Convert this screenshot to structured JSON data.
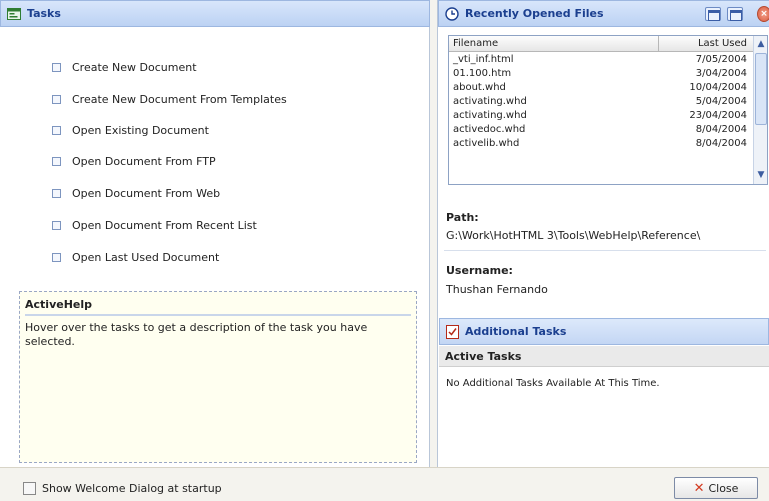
{
  "tasks": {
    "title": "Tasks",
    "items": [
      "Create New Document",
      "Create New Document From Templates",
      "Open Existing Document",
      "Open Document From FTP",
      "Open Document From Web",
      "Open Document From Recent List",
      "Open Last Used Document"
    ]
  },
  "active_help": {
    "title": "ActiveHelp",
    "text": "Hover over the tasks to get a description of the task you have selected."
  },
  "recent_files": {
    "title": "Recently Opened Files",
    "columns": [
      "Filename",
      "Last Used"
    ],
    "rows": [
      {
        "filename": "_vti_inf.html",
        "last_used": "7/05/2004"
      },
      {
        "filename": "01.100.htm",
        "last_used": "3/04/2004"
      },
      {
        "filename": "about.whd",
        "last_used": "10/04/2004"
      },
      {
        "filename": "activating.whd",
        "last_used": "5/04/2004"
      },
      {
        "filename": "activating.whd",
        "last_used": "23/04/2004"
      },
      {
        "filename": "activedoc.whd",
        "last_used": "8/04/2004"
      },
      {
        "filename": "activelib.whd",
        "last_used": "8/04/2004"
      }
    ],
    "icons": [
      "clock-icon",
      "window-icon",
      "window-icon",
      "close-icon"
    ]
  },
  "details": {
    "path_label": "Path:",
    "path_value": "G:\\Work\\HotHTML 3\\Tools\\WebHelp\\Reference\\",
    "username_label": "Username:",
    "username_value": "Thushan Fernando"
  },
  "additional_tasks": {
    "title": "Additional Tasks",
    "active_label": "Active Tasks",
    "message": "No Additional Tasks Available At This Time."
  },
  "footer": {
    "startup_label": "Show Welcome Dialog at startup",
    "close_label": "Close"
  },
  "colors": {
    "header_text": "#1b3f8f",
    "header_bg": "#c4d8f4",
    "help_bg": "#fffff0",
    "close_icon": "#d33a21"
  }
}
